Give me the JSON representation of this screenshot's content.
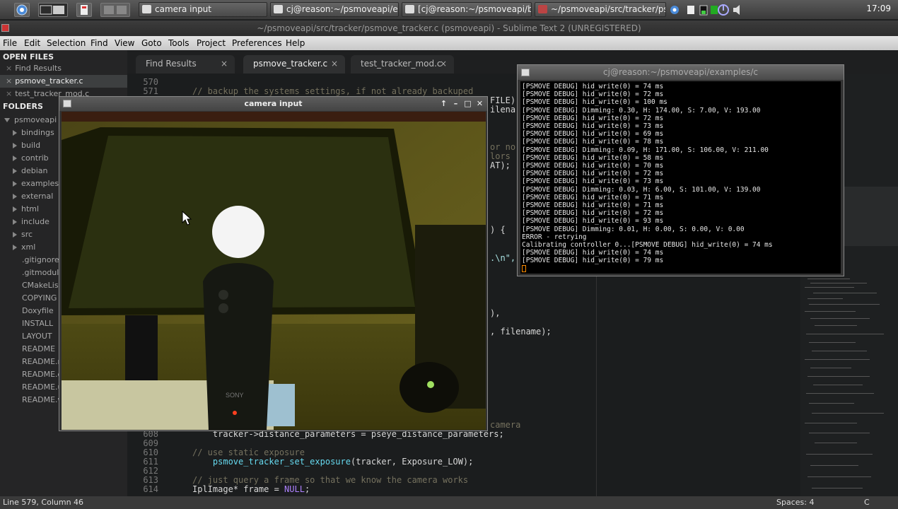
{
  "taskbar": {
    "tasks": [
      {
        "label": "camera input"
      },
      {
        "label": "cj@reason:~/psmoveapi/ex..."
      },
      {
        "label": "[cj@reason:~/psmoveapi/b..."
      },
      {
        "label": "~/psmoveapi/src/tracker/ps..."
      }
    ],
    "clock": "17:09"
  },
  "window_title": "~/psmoveapi/src/tracker/psmove_tracker.c (psmoveapi) - Sublime Text 2 (UNREGISTERED)",
  "menu": [
    "File",
    "Edit",
    "Selection",
    "Find",
    "View",
    "Goto",
    "Tools",
    "Project",
    "Preferences",
    "Help"
  ],
  "sidebar": {
    "open_files_heading": "OPEN FILES",
    "open_files": [
      "Find Results",
      "psmove_tracker.c",
      "test_tracker_mod.c"
    ],
    "folders_heading": "FOLDERS",
    "root": "psmoveapi",
    "folders": [
      "bindings",
      "build",
      "contrib",
      "debian",
      "examples",
      "external",
      "html",
      "include",
      "src",
      "xml"
    ],
    "files": [
      ".gitignore",
      ".gitmodul",
      "CMakeLis",
      "COPYING",
      "Doxyfile",
      "INSTALL",
      "LAYOUT",
      "README",
      "README.r",
      "README.c",
      "README.u",
      "README.w"
    ]
  },
  "tabs": [
    {
      "label": "Find Results",
      "close": "×"
    },
    {
      "label": "psmove_tracker.c",
      "close": "×"
    },
    {
      "label": "test_tracker_mod.c",
      "close": "×"
    }
  ],
  "code_top": [
    {
      "ln": "570",
      "text": ""
    },
    {
      "ln": "571",
      "text": "// backup the systems settings, if not already backuped"
    }
  ],
  "code_fragments": [
    "FILE)",
    "ilena",
    "or no",
    "lors",
    "AT);",
    ") {",
    ".\\n\",",
    "),",
    ", filename);",
    "camera"
  ],
  "code_bottom": [
    {
      "ln": "608",
      "text": "    tracker->distance_parameters = pseye_distance_parameters;"
    },
    {
      "ln": "609",
      "text": ""
    },
    {
      "ln": "610",
      "text": "// use static exposure"
    },
    {
      "ln": "611",
      "pre": "    ",
      "fn": "psmove_tracker_set_exposure",
      "post": "(tracker, Exposure_LOW);"
    },
    {
      "ln": "612",
      "text": ""
    },
    {
      "ln": "613",
      "text": "// just query a frame so that we know the camera works"
    },
    {
      "ln": "614",
      "pre": "IplImage* frame = ",
      "kw": "NULL",
      "post": ";"
    }
  ],
  "status": {
    "position": "Line 579, Column 46",
    "spaces": "Spaces: 4",
    "syntax": "C"
  },
  "camera_window": {
    "title": "camera input",
    "brand_text": "SONY"
  },
  "terminal": {
    "title": "cj@reason:~/psmoveapi/examples/c",
    "lines": [
      "[PSMOVE DEBUG] hid_write(0) = 74 ms",
      "[PSMOVE DEBUG] hid_write(0) = 72 ms",
      "[PSMOVE DEBUG] hid_write(0) = 100 ms",
      "[PSMOVE DEBUG] Dimming: 0.30, H: 174.00, S: 7.00, V: 193.00",
      "[PSMOVE DEBUG] hid_write(0) = 72 ms",
      "[PSMOVE DEBUG] hid_write(0) = 73 ms",
      "[PSMOVE DEBUG] hid_write(0) = 69 ms",
      "[PSMOVE DEBUG] hid_write(0) = 78 ms",
      "[PSMOVE DEBUG] Dimming: 0.09, H: 171.00, S: 106.00, V: 211.00",
      "[PSMOVE DEBUG] hid_write(0) = 58 ms",
      "[PSMOVE DEBUG] hid_write(0) = 70 ms",
      "[PSMOVE DEBUG] hid_write(0) = 72 ms",
      "[PSMOVE DEBUG] hid_write(0) = 73 ms",
      "[PSMOVE DEBUG] Dimming: 0.03, H: 6.00, S: 101.00, V: 139.00",
      "[PSMOVE DEBUG] hid_write(0) = 71 ms",
      "[PSMOVE DEBUG] hid_write(0) = 71 ms",
      "[PSMOVE DEBUG] hid_write(0) = 72 ms",
      "[PSMOVE DEBUG] hid_write(0) = 93 ms",
      "[PSMOVE DEBUG] Dimming: 0.01, H: 0.00, S: 0.00, V: 0.00",
      "ERROR - retrying",
      "Calibrating controller 0...[PSMOVE DEBUG] hid_write(0) = 74 ms",
      "[PSMOVE DEBUG] hid_write(0) = 74 ms",
      "[PSMOVE DEBUG] hid_write(0) = 79 ms"
    ]
  }
}
